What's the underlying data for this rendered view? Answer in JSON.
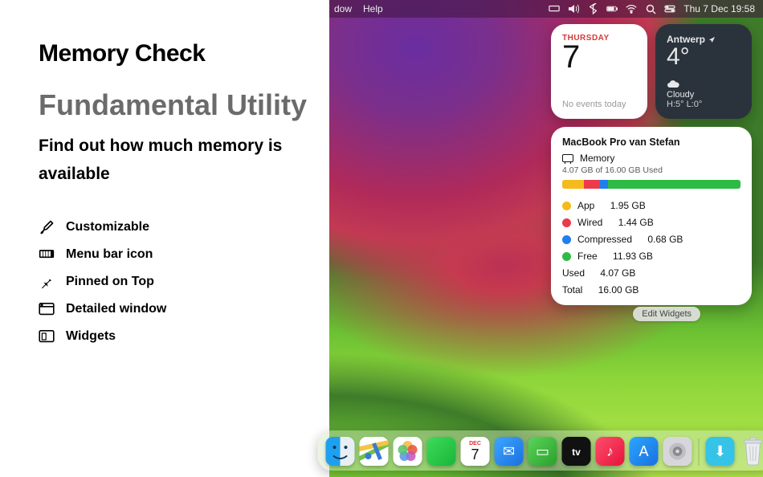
{
  "title": "Memory Check",
  "tagline": "Fundamental Utility",
  "subtitle": "Find out how much memory is available",
  "features": [
    {
      "label": "Customizable"
    },
    {
      "label": "Menu bar icon"
    },
    {
      "label": "Pinned on Top"
    },
    {
      "label": "Detailed window"
    },
    {
      "label": "Widgets"
    }
  ],
  "menubar": {
    "items": [
      "dow",
      "Help"
    ],
    "datetime": "Thu 7 Dec  19:58"
  },
  "calendar": {
    "dow": "THURSDAY",
    "day": "7",
    "events": "No events today"
  },
  "weather": {
    "location": "Antwerp",
    "temp": "4°",
    "condition": "Cloudy",
    "hilo": "H:5° L:0°"
  },
  "memory": {
    "device": "MacBook Pro van Stefan",
    "label": "Memory",
    "usage_line": "4.07 GB of 16.00 GB Used",
    "segments": {
      "app": {
        "label": "App",
        "value": "1.95 GB",
        "pct": 12.2,
        "color": "#f5ba1c"
      },
      "wired": {
        "label": "Wired",
        "value": "1.44 GB",
        "pct": 9.0,
        "color": "#eb3b4a"
      },
      "comp": {
        "label": "Compressed",
        "value": "0.68 GB",
        "pct": 4.3,
        "color": "#1f7ef0"
      },
      "free": {
        "label": "Free",
        "value": "11.93 GB",
        "pct": 74.5,
        "color": "#2dbb46"
      }
    },
    "used": {
      "label": "Used",
      "value": "4.07 GB"
    },
    "total": {
      "label": "Total",
      "value": "16.00 GB"
    }
  },
  "edit_widgets_label": "Edit Widgets",
  "dock": {
    "items": [
      {
        "name": "finder",
        "bg": "linear-gradient(135deg,#2aa7f3,#1172d4)",
        "glyph": ""
      },
      {
        "name": "maps",
        "bg": "#fff",
        "glyph": ""
      },
      {
        "name": "photos",
        "bg": "#fff",
        "glyph": ""
      },
      {
        "name": "facetime",
        "bg": "linear-gradient(135deg,#3ddc5a,#19b53a)",
        "glyph": ""
      },
      {
        "name": "calendar",
        "bg": "#fff",
        "glyph": "7",
        "day": "DEC"
      },
      {
        "name": "mail",
        "bg": "linear-gradient(135deg,#3ea6ff,#1b6fe0)",
        "glyph": "✉"
      },
      {
        "name": "memory",
        "bg": "linear-gradient(135deg,#5bd45b,#2aa02a)",
        "glyph": "▭"
      },
      {
        "name": "appletv",
        "bg": "#111",
        "glyph": "tv"
      },
      {
        "name": "music",
        "bg": "linear-gradient(135deg,#ff4e6b,#e6133c)",
        "glyph": "♪"
      },
      {
        "name": "appstore",
        "bg": "linear-gradient(135deg,#2ca6ff,#1a6fe0)",
        "glyph": "A"
      },
      {
        "name": "settings",
        "bg": "#d7d7db",
        "glyph": "⚙"
      }
    ],
    "after_sep": [
      {
        "name": "downloads",
        "bg": "#35c4e8",
        "glyph": "⬇"
      }
    ]
  },
  "chart_data": {
    "type": "bar",
    "title": "Memory usage",
    "categories": [
      "App",
      "Wired",
      "Compressed",
      "Free"
    ],
    "values": [
      1.95,
      1.44,
      0.68,
      11.93
    ],
    "ylabel": "GB",
    "ylim": [
      0,
      16
    ],
    "total": 16.0,
    "used": 4.07
  }
}
